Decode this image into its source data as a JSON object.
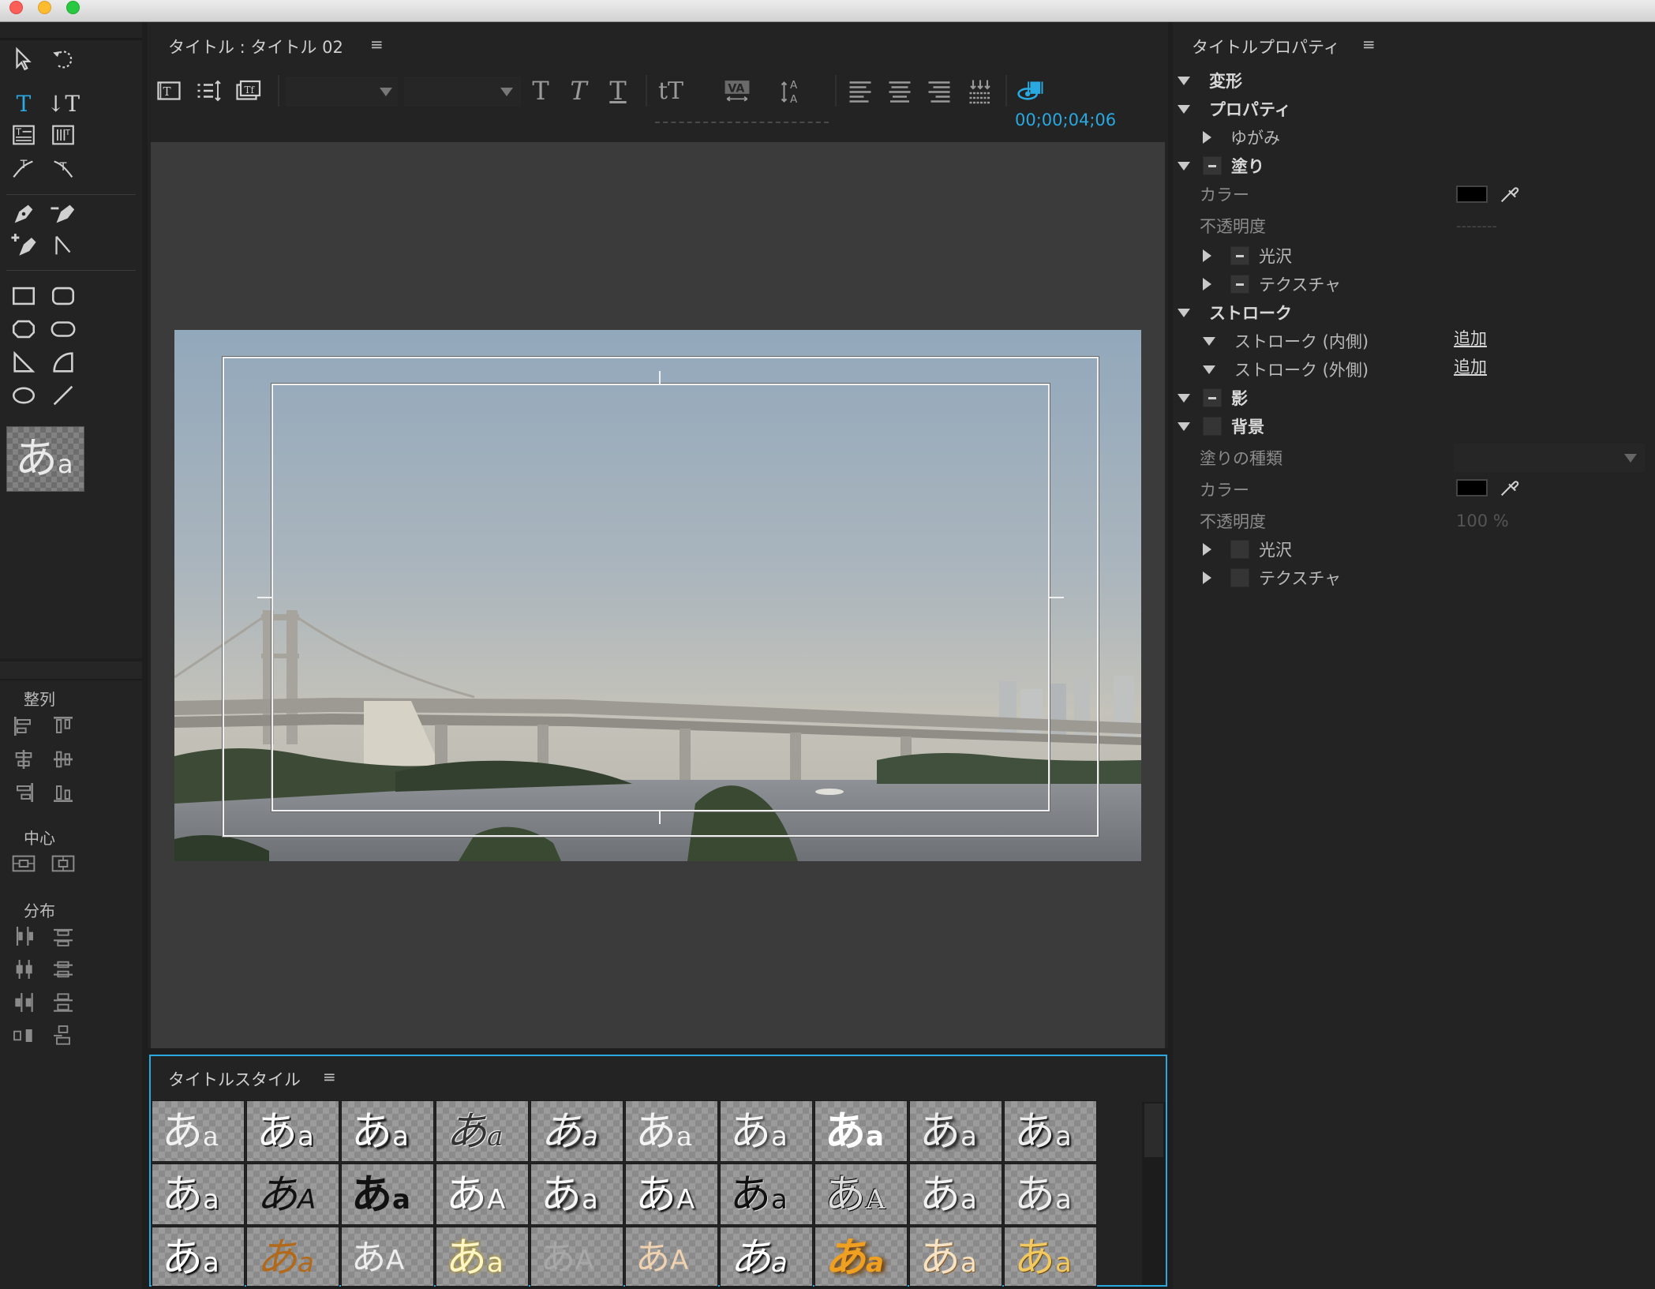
{
  "title_panel": {
    "title": "タイトル : タイトル 02",
    "menu_icon": "≡"
  },
  "timecode": "00;00;04;06",
  "tools_panel": {
    "preview_glyph": "あ",
    "preview_glyph_small": "a",
    "sections": {
      "align": "整列",
      "center": "中心",
      "distribute": "分布"
    }
  },
  "properties_panel": {
    "title": "タイトルプロパティ",
    "menu_icon": "≡",
    "rows": {
      "transform": "変形",
      "properties": "プロパティ",
      "distort": "ゆがみ",
      "fill": "塗り",
      "fill_color_label": "カラー",
      "fill_opacity_label": "不透明度",
      "fill_opacity_value": "--------",
      "fill_sheen": "光沢",
      "fill_texture": "テクスチャ",
      "stroke": "ストローク",
      "stroke_inner": "ストローク (内側)",
      "stroke_outer": "ストローク (外側)",
      "add_label": "追加",
      "shadow": "影",
      "background": "背景",
      "bg_fill_type_label": "塗りの種類",
      "bg_color_label": "カラー",
      "bg_opacity_label": "不透明度",
      "bg_opacity_value": "100 %",
      "bg_sheen": "光沢",
      "bg_texture": "テクスチャ"
    }
  },
  "styles_panel": {
    "title": "タイトルスタイル",
    "menu_icon": "≡",
    "rows": [
      [
        "あa",
        "あa",
        "あa",
        "あa",
        "あa",
        "あa",
        "あa",
        "あa",
        "あa",
        "あa"
      ],
      [
        "あa",
        "あA",
        "あa",
        "あA",
        "あa",
        "あA",
        "あa",
        "あA",
        "あa",
        "あa"
      ],
      [
        "あa",
        "あa",
        "あA",
        "あa",
        "あA",
        "あA",
        "あa",
        "あa",
        "あa",
        "あa"
      ]
    ]
  },
  "colors": {
    "accent": "#2aa8e0",
    "panel_bg": "#232323",
    "canvas_bg": "#3b3b3b"
  }
}
